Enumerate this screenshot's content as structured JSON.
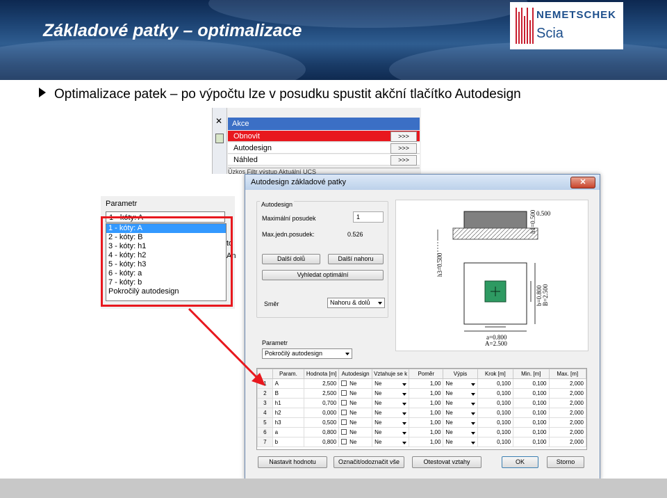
{
  "slide": {
    "title": "Základové patky – optimalizace",
    "bullet": "Optimalizace patek – po výpočtu lze v posudku spustit akční tlačítko Autodesign"
  },
  "logo": {
    "brand": "NEMETSCHEK",
    "product": "Scia",
    "color": "#1d4f8c"
  },
  "actions_panel": {
    "header": "Akce",
    "rows": [
      {
        "label": "Obnovit",
        "button": ">>>",
        "selected": true
      },
      {
        "label": "Autodesign",
        "button": ">>>",
        "selected": false
      },
      {
        "label": "Náhled",
        "button": ">>>",
        "selected": false
      }
    ],
    "tabs_partial": "Úzkos    Filtr výstup    Aktuální UCS"
  },
  "param_dropdown": {
    "label": "Parametr",
    "selected": "1 - kóty: A",
    "options": [
      "1 - kóty: A",
      "2 - kóty: B",
      "3 - kóty: h1",
      "4 - kóty: h2",
      "5 - kóty: h3",
      "6 - kóty: a",
      "7 - kóty: b",
      "Pokročilý autodesign"
    ],
    "peek_1": "to",
    "peek_2": "An",
    "highlight_color": "#e8181e"
  },
  "dialog": {
    "title": "Autodesign základové patky",
    "close": "✕",
    "autodesign_group": {
      "label": "Autodesign",
      "max_checks_label": "Maximální posudek",
      "max_checks_value": "1",
      "max_unit_label": "Max.jedn.posudek:",
      "max_unit_value": "0.526",
      "btn_next_down": "Další dolů",
      "btn_next_up": "Další nahoru",
      "btn_find_optimal": "Vyhledat optimální",
      "direction_label": "Směr",
      "direction_value": "Nahoru & dolů"
    },
    "preview": {
      "dim_h3": "h3=0.500",
      "dim_h1": "h1=0.500",
      "dim_top": "0.500",
      "dim_b": "b=0.800",
      "dim_B": "B=2.500",
      "dim_a": "a=0.800",
      "dim_A": "A=2.500"
    },
    "param_group": {
      "label": "Parametr",
      "value": "Pokročilý autodesign"
    },
    "grid": {
      "columns": [
        "",
        "Param.",
        "Hodnota [m]",
        "Autodesign",
        "Vztahuje se k",
        "Poměr",
        "Výpis",
        "Krok [m]",
        "Min. [m]",
        "Max. [m]"
      ],
      "rows": [
        {
          "n": "1",
          "param": "A",
          "value": "2,500",
          "auto": "Ne",
          "rel": "Ne",
          "ratio": "1,00",
          "out": "Ne",
          "step": "0,100",
          "min": "0,100",
          "max": "2,000"
        },
        {
          "n": "2",
          "param": "B",
          "value": "2,500",
          "auto": "Ne",
          "rel": "Ne",
          "ratio": "1,00",
          "out": "Ne",
          "step": "0,100",
          "min": "0,100",
          "max": "2,000"
        },
        {
          "n": "3",
          "param": "h1",
          "value": "0,700",
          "auto": "Ne",
          "rel": "Ne",
          "ratio": "1,00",
          "out": "Ne",
          "step": "0,100",
          "min": "0,100",
          "max": "2,000"
        },
        {
          "n": "4",
          "param": "h2",
          "value": "0,000",
          "auto": "Ne",
          "rel": "Ne",
          "ratio": "1,00",
          "out": "Ne",
          "step": "0,100",
          "min": "0,100",
          "max": "2,000"
        },
        {
          "n": "5",
          "param": "h3",
          "value": "0,500",
          "auto": "Ne",
          "rel": "Ne",
          "ratio": "1,00",
          "out": "Ne",
          "step": "0,100",
          "min": "0,100",
          "max": "2,000"
        },
        {
          "n": "6",
          "param": "a",
          "value": "0,800",
          "auto": "Ne",
          "rel": "Ne",
          "ratio": "1,00",
          "out": "Ne",
          "step": "0,100",
          "min": "0,100",
          "max": "2,000"
        },
        {
          "n": "7",
          "param": "b",
          "value": "0,800",
          "auto": "Ne",
          "rel": "Ne",
          "ratio": "1,00",
          "out": "Ne",
          "step": "0,100",
          "min": "0,100",
          "max": "2,000"
        }
      ]
    },
    "footer_buttons": {
      "set_value": "Nastavit hodnotu",
      "toggle_all": "Označit/odoznačit vše",
      "test_relations": "Otestovat vztahy",
      "ok": "OK",
      "cancel": "Storno"
    }
  }
}
